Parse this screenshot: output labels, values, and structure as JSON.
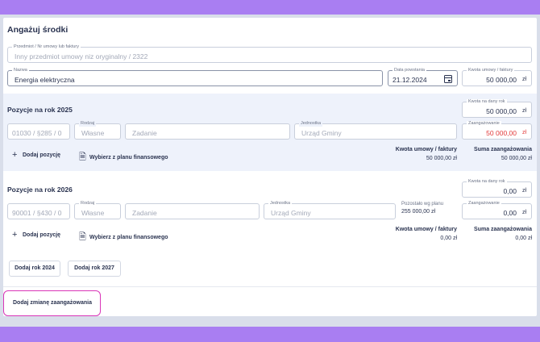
{
  "form": {
    "title": "Angażuj środki",
    "subject": {
      "label": "Przedmiot / Nr umowy lub faktury",
      "placeholder": "Inny przedmiot umowy niz oryginalny / 2322"
    },
    "name": {
      "label": "Nazwa",
      "value": "Energia elektryczna"
    },
    "date": {
      "label": "Data powstania",
      "value": "21.12.2024"
    },
    "amount": {
      "label": "Kwota umowy / faktury",
      "value": "50 000,00",
      "unit": "zł"
    }
  },
  "year2025": {
    "title": "Pozycje na rok 2025",
    "code": "01030 / §285 / 0",
    "type_label": "Rodzaj",
    "type": "Własne",
    "task": "Zadanie",
    "unit_label": "Jednostka",
    "unit": "Urząd Gminy",
    "amount_year_label": "Kwota na dany rok",
    "amount_year": "50 000,00",
    "commitment_label": "Zaangażowanie",
    "commitment": "50 000,00",
    "currency": "zł",
    "add_position": "Dodaj pozycję",
    "choose_plan": "Wybierz z planu finansowego",
    "contract_amount_label": "Kwota umowy / faktury",
    "contract_amount": "50 000,00 zł",
    "commitment_sum_label": "Suma zaangażowania",
    "commitment_sum": "50 000,00 zł"
  },
  "year2026": {
    "title": "Pozycje na rok 2026",
    "code": "90001 / §430 / 0",
    "type_label": "Rodzaj",
    "type": "Własne",
    "task": "Zadanie",
    "unit_label": "Jednostka",
    "unit": "Urząd Gminy",
    "remaining_label": "Pozostało wg planu",
    "remaining": "255 000,00 zł",
    "amount_year_label": "Kwota na dany rok",
    "amount_year": "0,00",
    "commitment_label": "Zaangażowanie",
    "commitment": "0,00",
    "currency": "zł",
    "add_position": "Dodaj pozycję",
    "choose_plan": "Wybierz z planu finansowego",
    "contract_amount_label": "Kwota umowy / faktury",
    "contract_amount": "0,00 zł",
    "commitment_sum_label": "Suma zaangażowania",
    "commitment_sum": "0,00 zł"
  },
  "actions": {
    "add_year_2024": "Dodaj rok 2024",
    "add_year_2027": "Dodaj rok 2027",
    "add_change": "Dodaj zmianę zaangażowania"
  },
  "colors": {
    "accent": "#a97ef2",
    "highlight": "#d936b8",
    "error": "#e23a3a"
  }
}
